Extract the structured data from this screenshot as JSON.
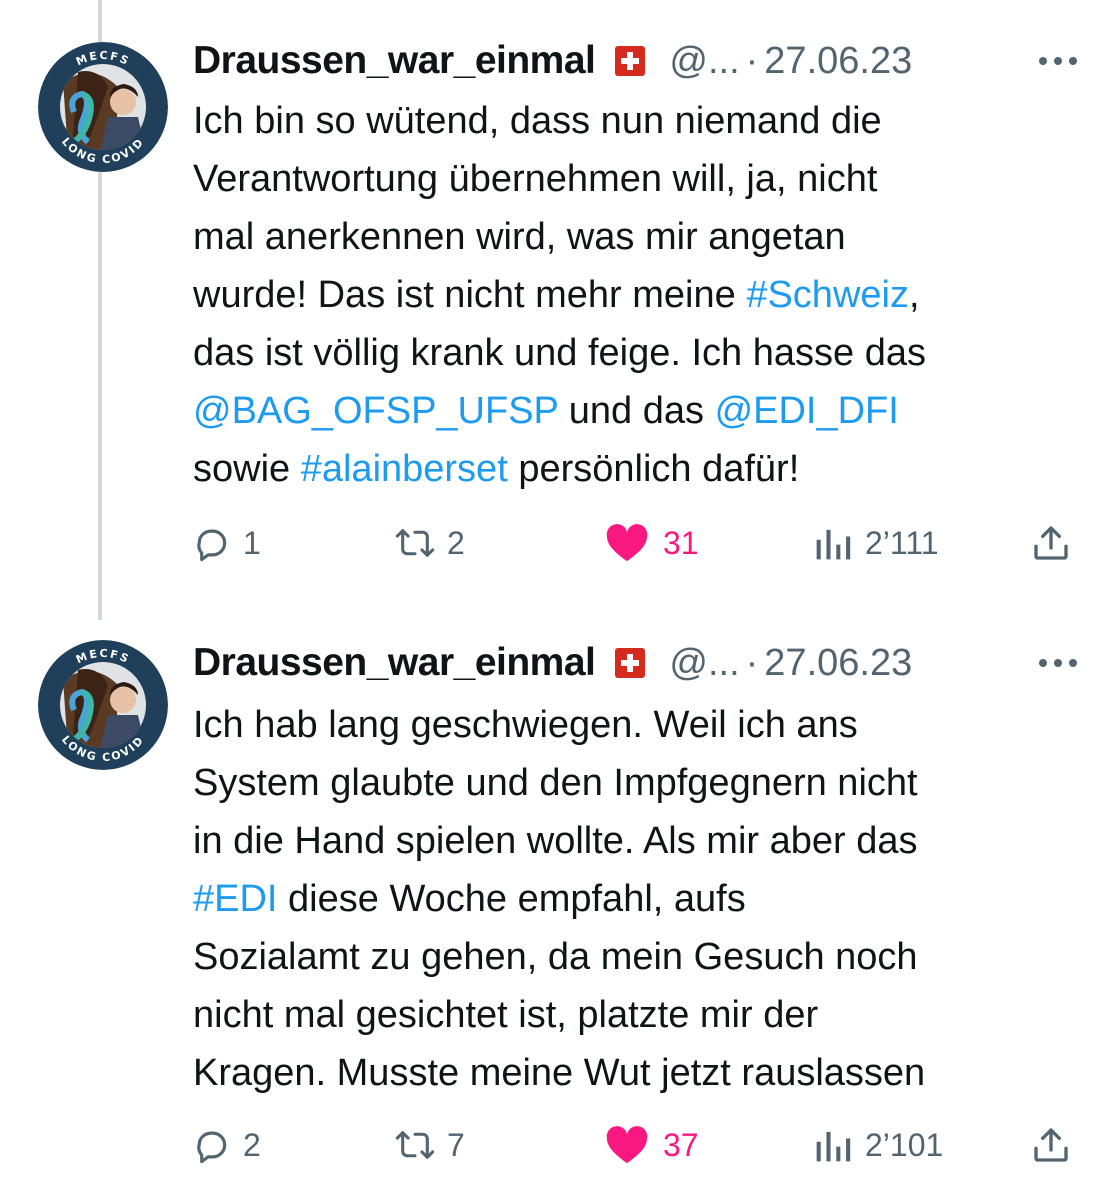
{
  "tweets": [
    {
      "author": {
        "display_name": "Draussen_war_einmal",
        "handle": "@...",
        "flag": "swiss-flag",
        "avatar_ring_top": "MECFS",
        "avatar_ring_bottom": "LONG COVID"
      },
      "separator": "·",
      "date": "27.06.23",
      "text_lines": [
        [
          {
            "t": "Ich bin so wütend, dass nun niemand die",
            "link": false
          }
        ],
        [
          {
            "t": "Verantwortung übernehmen will, ja, nicht",
            "link": false
          }
        ],
        [
          {
            "t": "mal anerkennen wird, was mir angetan",
            "link": false
          }
        ],
        [
          {
            "t": "wurde! Das ist nicht mehr meine ",
            "link": false
          },
          {
            "t": "#Schweiz",
            "link": true
          },
          {
            "t": ",",
            "link": false
          }
        ],
        [
          {
            "t": "das ist völlig krank und feige. Ich hasse das",
            "link": false
          }
        ],
        [
          {
            "t": "@BAG_OFSP_UFSP",
            "link": true
          },
          {
            "t": " und das ",
            "link": false
          },
          {
            "t": "@EDI_DFI",
            "link": true
          }
        ],
        [
          {
            "t": "sowie ",
            "link": false
          },
          {
            "t": "#alainberset",
            "link": true
          },
          {
            "t": " persönlich dafür!",
            "link": false
          }
        ]
      ],
      "stats": {
        "replies": "1",
        "retweets": "2",
        "likes": "31",
        "views": "2’111"
      }
    },
    {
      "author": {
        "display_name": "Draussen_war_einmal",
        "handle": "@...",
        "flag": "swiss-flag",
        "avatar_ring_top": "MECFS",
        "avatar_ring_bottom": "LONG COVID"
      },
      "separator": "·",
      "date": "27.06.23",
      "text_lines": [
        [
          {
            "t": "Ich hab lang geschwiegen. Weil ich ans",
            "link": false
          }
        ],
        [
          {
            "t": "System glaubte und den Impfgegnern nicht",
            "link": false
          }
        ],
        [
          {
            "t": "in die Hand spielen wollte. Als mir aber das",
            "link": false
          }
        ],
        [
          {
            "t": "#EDI",
            "link": true
          },
          {
            "t": "  diese Woche empfahl, aufs",
            "link": false
          }
        ],
        [
          {
            "t": "Sozialamt zu gehen, da mein Gesuch noch",
            "link": false
          }
        ],
        [
          {
            "t": "nicht mal gesichtet ist, platzte mir der",
            "link": false
          }
        ],
        [
          {
            "t": "Kragen. Musste meine Wut jetzt rauslassen",
            "link": false
          }
        ]
      ],
      "stats": {
        "replies": "2",
        "retweets": "7",
        "likes": "37",
        "views": "2’101"
      }
    }
  ],
  "colors": {
    "text": "#0f1419",
    "muted": "#536471",
    "link": "#1d9bf0",
    "like": "#f91880",
    "thread_line": "#cfd9de",
    "avatar_ring": "#1f3f5a",
    "avatar_ring_text": "#ffffff",
    "ribbon_blue": "#4aa3d9",
    "ribbon_teal": "#3fb6a8"
  },
  "icons": {
    "reply": "reply-bubble-icon",
    "retweet": "retweet-arrows-icon",
    "like": "heart-filled-icon",
    "views": "views-bars-icon",
    "share": "share-upload-icon",
    "more": "more-dots-icon"
  }
}
